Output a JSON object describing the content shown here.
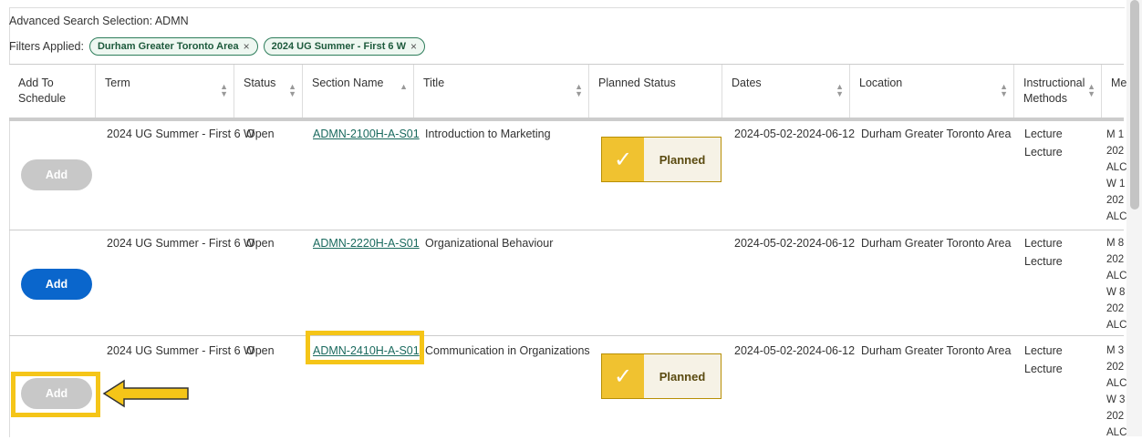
{
  "search": {
    "label": "Advanced Search Selection: ADMN"
  },
  "filters": {
    "label": "Filters Applied:",
    "chips": [
      "Durham Greater Toronto Area",
      "2024 UG Summer - First 6 W"
    ],
    "remove_glyph": "×"
  },
  "columns": {
    "add": "Add To Schedule",
    "term": "Term",
    "status": "Status",
    "section": "Section Name",
    "title": "Title",
    "planned": "Planned Status",
    "dates": "Dates",
    "location": "Location",
    "methods": "Instructional Methods",
    "meetings": "Me"
  },
  "rows": [
    {
      "add_label": "Add",
      "term": "2024 UG Summer - First 6 W",
      "status": "Open",
      "section": "ADMN-2100H-A-S01",
      "title": "Introduction to Marketing",
      "planned": "Planned",
      "dates": "2024-05-02-2024-06-12",
      "location": "Durham Greater Toronto Area",
      "methods": [
        "Lecture",
        "Lecture"
      ],
      "meetings": [
        "M 1",
        "202",
        "ALC",
        "W 1",
        "202",
        "ALC"
      ]
    },
    {
      "add_label": "Add",
      "term": "2024 UG Summer - First 6 W",
      "status": "Open",
      "section": "ADMN-2220H-A-S01",
      "title": "Organizational Behaviour",
      "planned": "",
      "dates": "2024-05-02-2024-06-12",
      "location": "Durham Greater Toronto Area",
      "methods": [
        "Lecture",
        "Lecture"
      ],
      "meetings": [
        "M 8",
        "202",
        "ALC",
        "W 8",
        "202",
        "ALC"
      ]
    },
    {
      "add_label": "Add",
      "term": "2024 UG Summer - First 6 W",
      "status": "Open",
      "section": "ADMN-2410H-A-S01",
      "title": "Communication in Organizations",
      "planned": "Planned",
      "dates": "2024-05-02-2024-06-12",
      "location": "Durham Greater Toronto Area",
      "methods": [
        "Lecture",
        "Lecture"
      ],
      "meetings": [
        "M 3",
        "202",
        "ALC",
        "W 3",
        "202",
        "ALC"
      ]
    }
  ],
  "icons": {
    "check": "check-icon",
    "sort": "sort-icon",
    "arrow": "arrow-left-icon",
    "remove": "close-icon"
  },
  "colors": {
    "highlight": "#f5c518",
    "planned_accent": "#f0c230",
    "add_active": "#0a66cc",
    "add_disabled": "#c8c8c8",
    "link": "#1a6a5e",
    "chip_border": "#2e7d5b"
  }
}
